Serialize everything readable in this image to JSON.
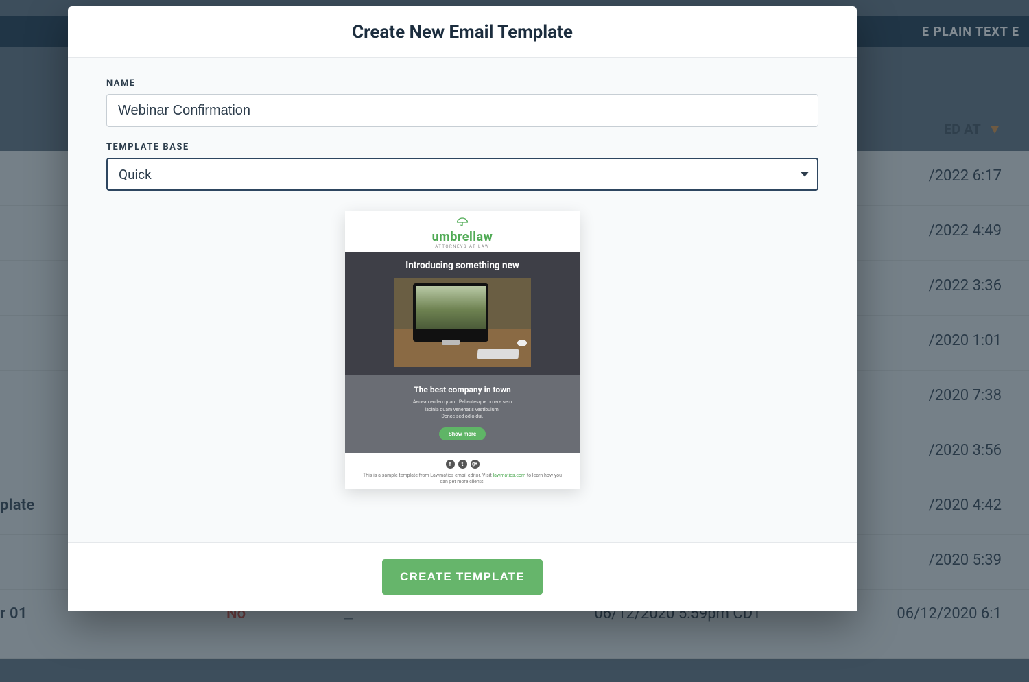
{
  "modal": {
    "title": "Create New Email Template",
    "name_label": "NAME",
    "name_value": "Webinar Confirmation",
    "base_label": "TEMPLATE BASE",
    "base_value": "Quick",
    "create_label": "CREATE TEMPLATE"
  },
  "preview": {
    "brand": "umbrellaw",
    "brand_tag": "ATTORNEYS AT LAW",
    "hero_title": "Introducing something new",
    "sub_title": "The best company in town",
    "sub_body1": "Aenean eu leo quam. Pellentesque ornare sem",
    "sub_body2": "lacinia quam venenatis vestibulum.",
    "sub_body3": "Donec sed odio dui.",
    "cta": "Show more",
    "social_f": "f",
    "social_t": "t",
    "social_g": "g+",
    "disclaimer_a": "This is a sample template from Lawmatics email editor. Visit ",
    "disclaimer_link": "lawmatics.com",
    "disclaimer_b": " to learn how you can get more clients."
  },
  "bg": {
    "header_btn": "E PLAIN TEXT E",
    "col_header": "ED AT",
    "rows": [
      "/2022 6:17",
      "/2022 4:49",
      "/2022 3:36",
      "/2020 1:01",
      "/2020 7:38",
      "/2020 3:56",
      "/2020 4:42",
      "/2020 5:39"
    ],
    "left_item_a": "plate",
    "left_item_b": "r 01",
    "row_no": "No",
    "bottom_ts_a": "06/12/2020 5:59pm CDT",
    "bottom_ts_b": "06/12/2020 6:1"
  }
}
